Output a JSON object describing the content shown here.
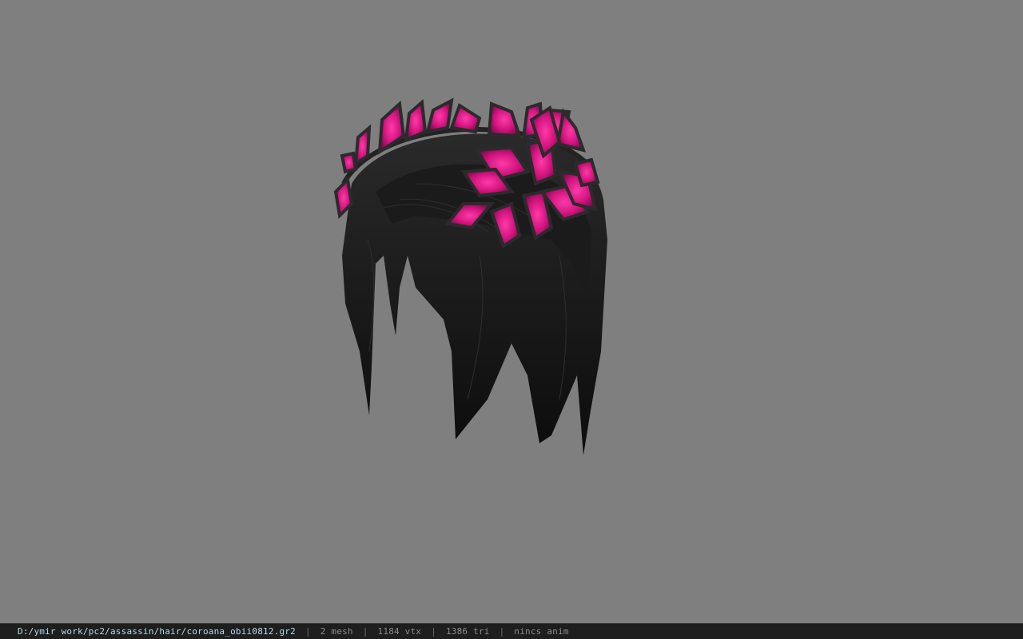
{
  "viewer": {
    "background_color": "#7f7f7f",
    "model": {
      "name": "hair-with-flower-crown",
      "hair_color": "#151515",
      "petal_color": "#d1137e",
      "petal_outline_color": "#2b2b2b"
    }
  },
  "status_bar": {
    "file_path": "D:/ymir work/pc2/assassin/hair/coroana_obii0812.gr2",
    "separator": "|",
    "mesh_count": "2 mesh",
    "vertex_count": "1184 vtx",
    "triangle_count": "1386 tri",
    "animation": "nincs anim"
  }
}
